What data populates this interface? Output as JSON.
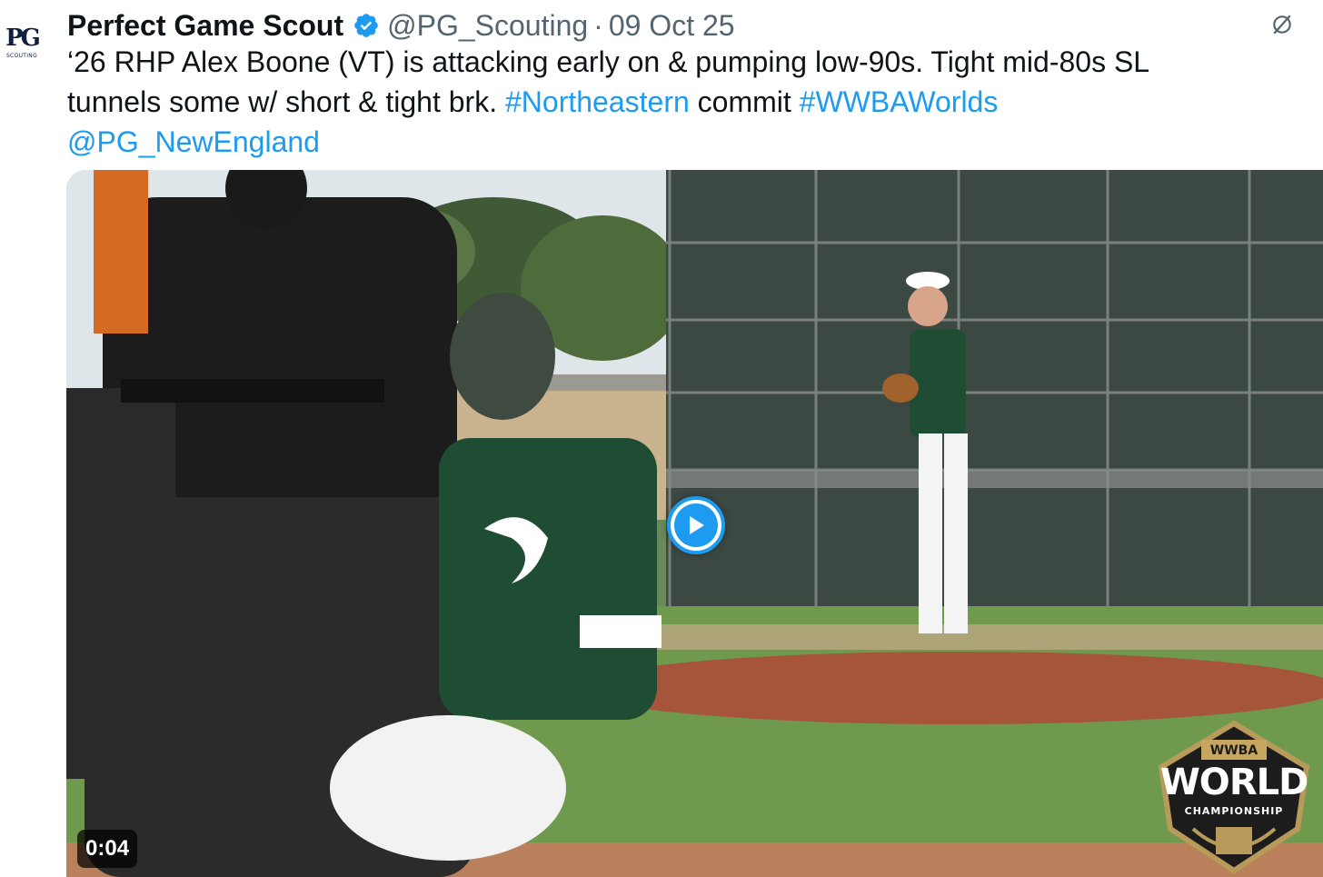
{
  "tweet": {
    "author_name": "Perfect Game Scout",
    "handle": "@PG_Scouting",
    "separator": "·",
    "date": "09 Oct 25",
    "avatar_text": "PG",
    "avatar_subtext": "SCOUTING",
    "text_lines": [
      [
        {
          "t": "‘26 RHP Alex Boone (VT) is attacking early on & pumping low-90s. Tight mid-80s SL",
          "link": false
        }
      ],
      [
        {
          "t": "tunnels some w/ short & tight brk. ",
          "link": false
        },
        {
          "t": "#Northeastern",
          "link": true
        },
        {
          "t": " commit ",
          "link": false
        },
        {
          "t": "#WWBAWorlds",
          "link": true
        }
      ],
      [
        {
          "t": "@PG_NewEngland",
          "link": true
        }
      ]
    ]
  },
  "media": {
    "duration": "0:04",
    "badge": {
      "top": "WWBA",
      "main": "WORLD",
      "sub": "CHAMPIONSHIP"
    }
  },
  "colors": {
    "link": "#1d9bf0",
    "secondary_text": "#536471",
    "verified": "#1d9bf0",
    "uniform_green": "#1f4d34"
  },
  "icons": {
    "verified": "verified-badge-icon",
    "more": "slashed-circle-icon",
    "play": "play-icon"
  }
}
